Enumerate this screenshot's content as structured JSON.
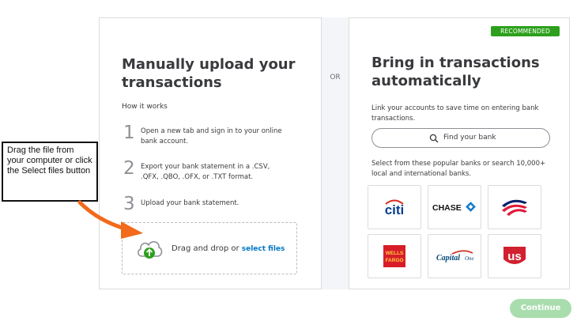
{
  "left": {
    "title": "Manually upload your transactions",
    "how_it_works": "How it works",
    "steps": [
      {
        "num": "1",
        "text": "Open a new tab and sign in to your online bank account."
      },
      {
        "num": "2",
        "text": "Export your bank statement in a .CSV, .QFX, .QBO, .OFX, or .TXT format."
      },
      {
        "num": "3",
        "text": "Upload your bank statement."
      }
    ],
    "drop_text": "Drag and drop or ",
    "select_files": "select files"
  },
  "divider": {
    "or": "OR"
  },
  "right": {
    "badge": "RECOMMENDED",
    "title": "Bring in transactions automatically",
    "description": "Link your accounts to save time on entering bank transactions.",
    "find_bank": "Find your bank",
    "popular": "Select from these popular banks or search 10,000+ local and international banks.",
    "banks": [
      {
        "name": "citi"
      },
      {
        "name": "CHASE"
      },
      {
        "name": "Bank of America"
      },
      {
        "name": "WELLS FARGO"
      },
      {
        "name": "Capital One"
      },
      {
        "name": "US"
      }
    ]
  },
  "callout": {
    "text": "Drag the file from your computer or click the Select files button"
  },
  "continue_label": "Continue",
  "colors": {
    "accent_green": "#2ca01c",
    "link_blue": "#0077c5",
    "continue_disabled": "#a9ddae",
    "arrow_orange": "#f26a1b"
  }
}
